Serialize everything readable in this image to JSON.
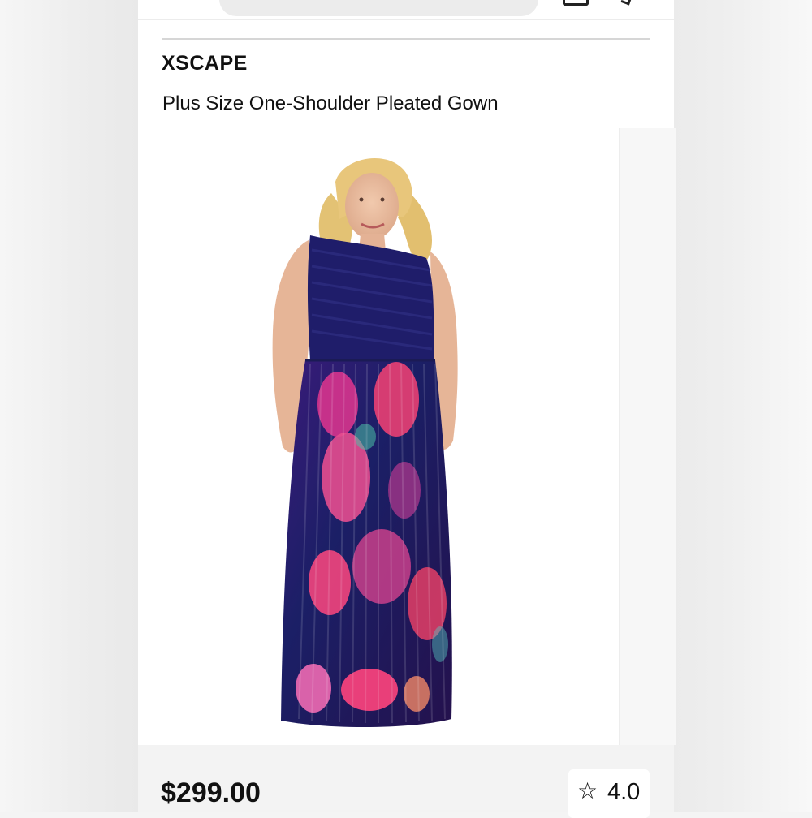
{
  "product": {
    "brand": "XSCAPE",
    "title": "Plus Size One-Shoulder Pleated Gown",
    "price": "$299.00",
    "rating": "4.0"
  },
  "icons": {
    "rating": "star-outline-icon",
    "top_left": "bag-icon",
    "top_right": "chevron-icon"
  },
  "colors": {
    "dress_top": "#1d1d66",
    "floral_pink": "#e0306a",
    "floral_magenta": "#b22a86",
    "skin": "#e8b79a",
    "hair": "#e6c67b"
  }
}
